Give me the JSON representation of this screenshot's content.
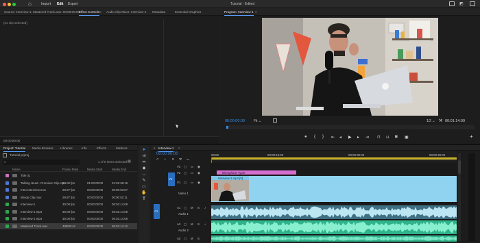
{
  "titlebar": {
    "nav": [
      "Import",
      "Edit",
      "Export"
    ],
    "active": "Edit",
    "doc_title": "Tutorial - Edited"
  },
  "panels": {
    "source_tab": "Source: Interview-1: Mastered Track.wav: 00:00:00:00",
    "effect_controls_tab": "Effect Controls",
    "audio_mixer_tab": "Audio Clip Mixer: Interview-1",
    "metadata_tab": "Metadata",
    "essential_graphics_tab": "Essential Graphics",
    "program_tab": "Program: Interview-1",
    "no_clip": "(no clip selected)",
    "src_timecode": "00:00:00:00"
  },
  "program": {
    "timecode": "00:00:00:00",
    "fit": "Fit",
    "quality": "1/2",
    "duration": "00:01:14:09"
  },
  "project": {
    "tabs": [
      "Project: Tutorial",
      "Media Browser",
      "Libraries",
      "Info",
      "Effects",
      "Markers"
    ],
    "path": "Tutorial.prproj",
    "selection": "1 of 8 items selected",
    "columns": [
      "Name",
      "Frame Rate",
      "Media Start",
      "Media End"
    ],
    "items": [
      {
        "name": "Title 01",
        "fr": "",
        "ms": "",
        "me": "",
        "color": "#cf6fc2"
      },
      {
        "name": "Talking Head - Premiere Clip.mp4",
        "fr": "24.00 fps",
        "ms": "01:00:00:00",
        "me": "01:01:28:15",
        "color": "#4f78d6"
      },
      {
        "name": "Intro-Interview.mov",
        "fr": "29.97 fps",
        "ms": "00:00:00:00",
        "me": "00:00:03:07",
        "color": "#4f78d6"
      },
      {
        "name": "Windy Clip.mov",
        "fr": "29.97 fps",
        "ms": "00:00:00:00",
        "me": "00:00:02:11",
        "color": "#4f78d6"
      },
      {
        "name": "Interview-1",
        "fr": "30.00 fps",
        "ms": "00:00:00:00",
        "me": "00:01:14:08",
        "color": "#2ea84f"
      },
      {
        "name": "Interview-1.mp4",
        "fr": "30.00 fps",
        "ms": "00:00:00:00",
        "me": "00:01:14:08",
        "color": "#2ea84f"
      },
      {
        "name": "Interview-1.mp4",
        "fr": "30.00 fps",
        "ms": "00:00:00:00",
        "me": "00:01:14:08",
        "color": "#2ea84f"
      },
      {
        "name": "Mastered Track.wav",
        "fr": "48000 Hz",
        "ms": "00:00:00:00",
        "me": "00:01:14:12",
        "color": "#2ea84f"
      }
    ]
  },
  "timeline": {
    "sequence": "Interview-1",
    "timecode": "00:00:00:00",
    "ruler": [
      "00:00",
      "00:00:15:00",
      "00:00:30:00",
      "00:00:45:00"
    ],
    "tracks": [
      "V3",
      "V2",
      "V1",
      "A1",
      "A2",
      "A3"
    ],
    "track_names": {
      "v1": "Video 1",
      "a1": "Audio 1",
      "a2": "Audio 2"
    },
    "graphic_clip": "Microphone Typer",
    "video_clip": "Interview-1.mp4 [V]",
    "src_patch_v": "V1",
    "src_patch_a": "A1"
  },
  "colors": {
    "accent": "#2d8ceb",
    "audio_clip": "#2fb38a",
    "video_track": "#8fd3f0",
    "graphic": "#d46fd0",
    "playhead": "#2d8ceb"
  }
}
